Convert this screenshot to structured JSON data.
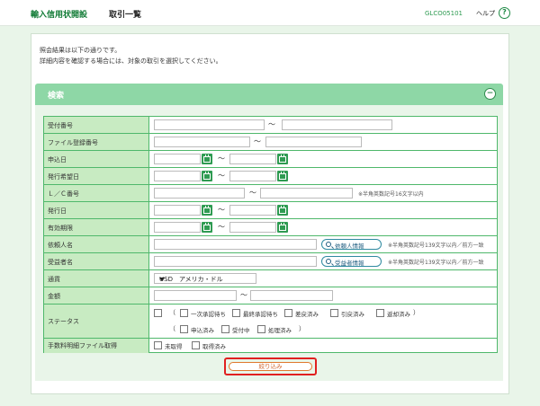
{
  "header": {
    "app_title": "輸入信用状開設",
    "page_title": "取引一覧",
    "screen_id": "GLCO05101",
    "help_label": "ヘルプ",
    "help_icon": "?"
  },
  "notice": {
    "line1": "照会結果は以下の通りです。",
    "line2": "詳細内容を確認する場合には、対象の取引を選択してください。"
  },
  "search": {
    "title": "検索",
    "collapse_icon": "−",
    "submit_label": "絞り込み"
  },
  "fields": {
    "receipt_no": "受付番号",
    "file_reg_no": "ファイル登録番号",
    "apply_date": "申込日",
    "issue_desired_date": "発行希望日",
    "lc_no": "Ｌ／Ｃ番号",
    "issue_date": "発行日",
    "expiry": "有効期限",
    "applicant_name": "依頼人名",
    "beneficiary_name": "受益者名",
    "currency": "通貨",
    "amount": "金額",
    "status": "ステータス",
    "fee_detail": "手数料明細ファイル取得"
  },
  "tilde": "～",
  "hints": {
    "lc_no_hint": "※半角英数記号16文字以内",
    "applicant_hint": "※半角英数記号139文字以内／前方一致",
    "beneficiary_hint": "※半角英数記号139文字以内／前方一致"
  },
  "buttons": {
    "applicant_info": "依頼人情報",
    "beneficiary_info": "受益者情報"
  },
  "currency_select": {
    "value": "USD　アメリカ・ドル"
  },
  "status_options": {
    "open_paren": "（",
    "close_paren": "）",
    "row1": [
      "一次承認待ち",
      "最終承認待ち",
      "差戻済み",
      "引戻済み",
      "返却済み"
    ],
    "row2": [
      "申込済み",
      "受付中",
      "処理済み"
    ]
  },
  "fee_options": [
    "未取得",
    "取得済み"
  ],
  "colors": {
    "brand_green": "#0f7a34",
    "search_header": "#8ed7a6",
    "label_bg": "#c8ebc2",
    "highlight": "#e02020"
  }
}
